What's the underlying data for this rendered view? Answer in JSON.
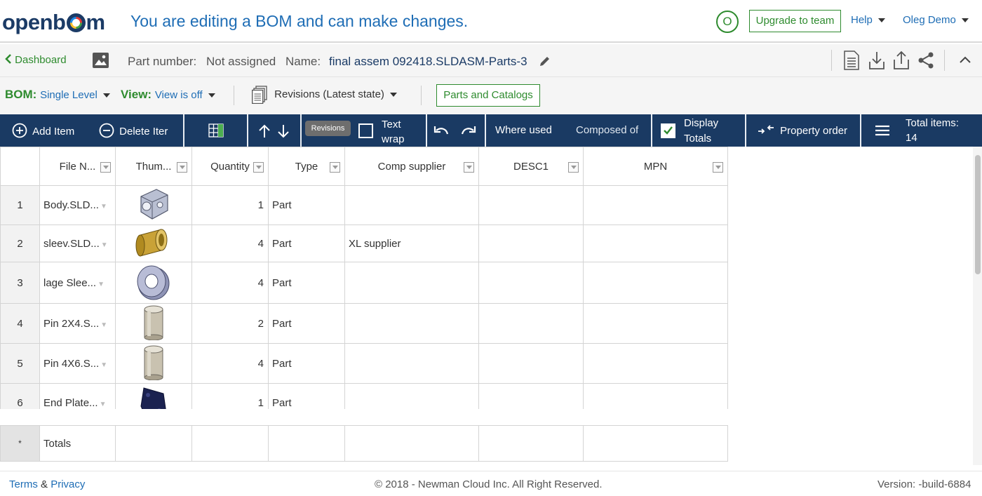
{
  "header": {
    "edit_message": "You are editing a BOM and can make changes.",
    "avatar_letter": "O",
    "upgrade_label": "Upgrade to team",
    "help_label": "Help",
    "user_label": "Oleg Demo"
  },
  "subbar": {
    "dashboard_label": "Dashboard",
    "part_number_label": "Part number:",
    "part_number_value": "Not assigned",
    "name_label": "Name:",
    "name_value": "final assem 092418.SLDASM-Parts-3"
  },
  "toolbar": {
    "bom_label": "BOM:",
    "bom_value": "Single Level",
    "view_label": "View:",
    "view_value": "View is off",
    "revisions_label": "Revisions (Latest state)",
    "parts_catalogs_label": "Parts and Catalogs"
  },
  "navbar": {
    "add_item": "Add Item",
    "delete_item": "Delete Iter",
    "tooltip": "Revisions",
    "text_wrap_1": "Text",
    "text_wrap_2": "wrap",
    "where_used": "Where used",
    "composed_of": "Composed of",
    "display_totals_1": "Display",
    "display_totals_2": "Totals",
    "property_order": "Property order",
    "total_items_label": "Total items:",
    "total_items_value": "14"
  },
  "grid": {
    "columns": [
      "File N...",
      "Thum...",
      "Quantity",
      "Type",
      "Comp supplier",
      "DESC1",
      "MPN"
    ],
    "rows": [
      {
        "num": "1",
        "file": "Body.SLD...",
        "thumb": "body",
        "qty": "1",
        "type": "Part",
        "supplier": "",
        "desc1": "",
        "mpn": ""
      },
      {
        "num": "2",
        "file": "sleev.SLD...",
        "thumb": "sleeve",
        "qty": "4",
        "type": "Part",
        "supplier": "XL supplier",
        "desc1": "",
        "mpn": ""
      },
      {
        "num": "3",
        "file": "lage Slee...",
        "thumb": "ring",
        "qty": "4",
        "type": "Part",
        "supplier": "",
        "desc1": "",
        "mpn": ""
      },
      {
        "num": "4",
        "file": "Pin 2X4.S...",
        "thumb": "pin",
        "qty": "2",
        "type": "Part",
        "supplier": "",
        "desc1": "",
        "mpn": ""
      },
      {
        "num": "5",
        "file": "Pin 4X6.S...",
        "thumb": "pin",
        "qty": "4",
        "type": "Part",
        "supplier": "",
        "desc1": "",
        "mpn": ""
      },
      {
        "num": "6",
        "file": "End Plate...",
        "thumb": "plate",
        "qty": "1",
        "type": "Part",
        "supplier": "",
        "desc1": "",
        "mpn": ""
      }
    ],
    "totals_marker": "*",
    "totals_label": "Totals"
  },
  "footer": {
    "terms": "Terms",
    "amp": "&",
    "privacy": "Privacy",
    "copyright": "© 2018 - Newman Cloud Inc. All Right Reserved.",
    "version": "Version: -build-6884"
  },
  "colors": {
    "brand_navy": "#1a3a63",
    "accent_green": "#2e8b2e",
    "link_blue": "#1e6db5"
  }
}
